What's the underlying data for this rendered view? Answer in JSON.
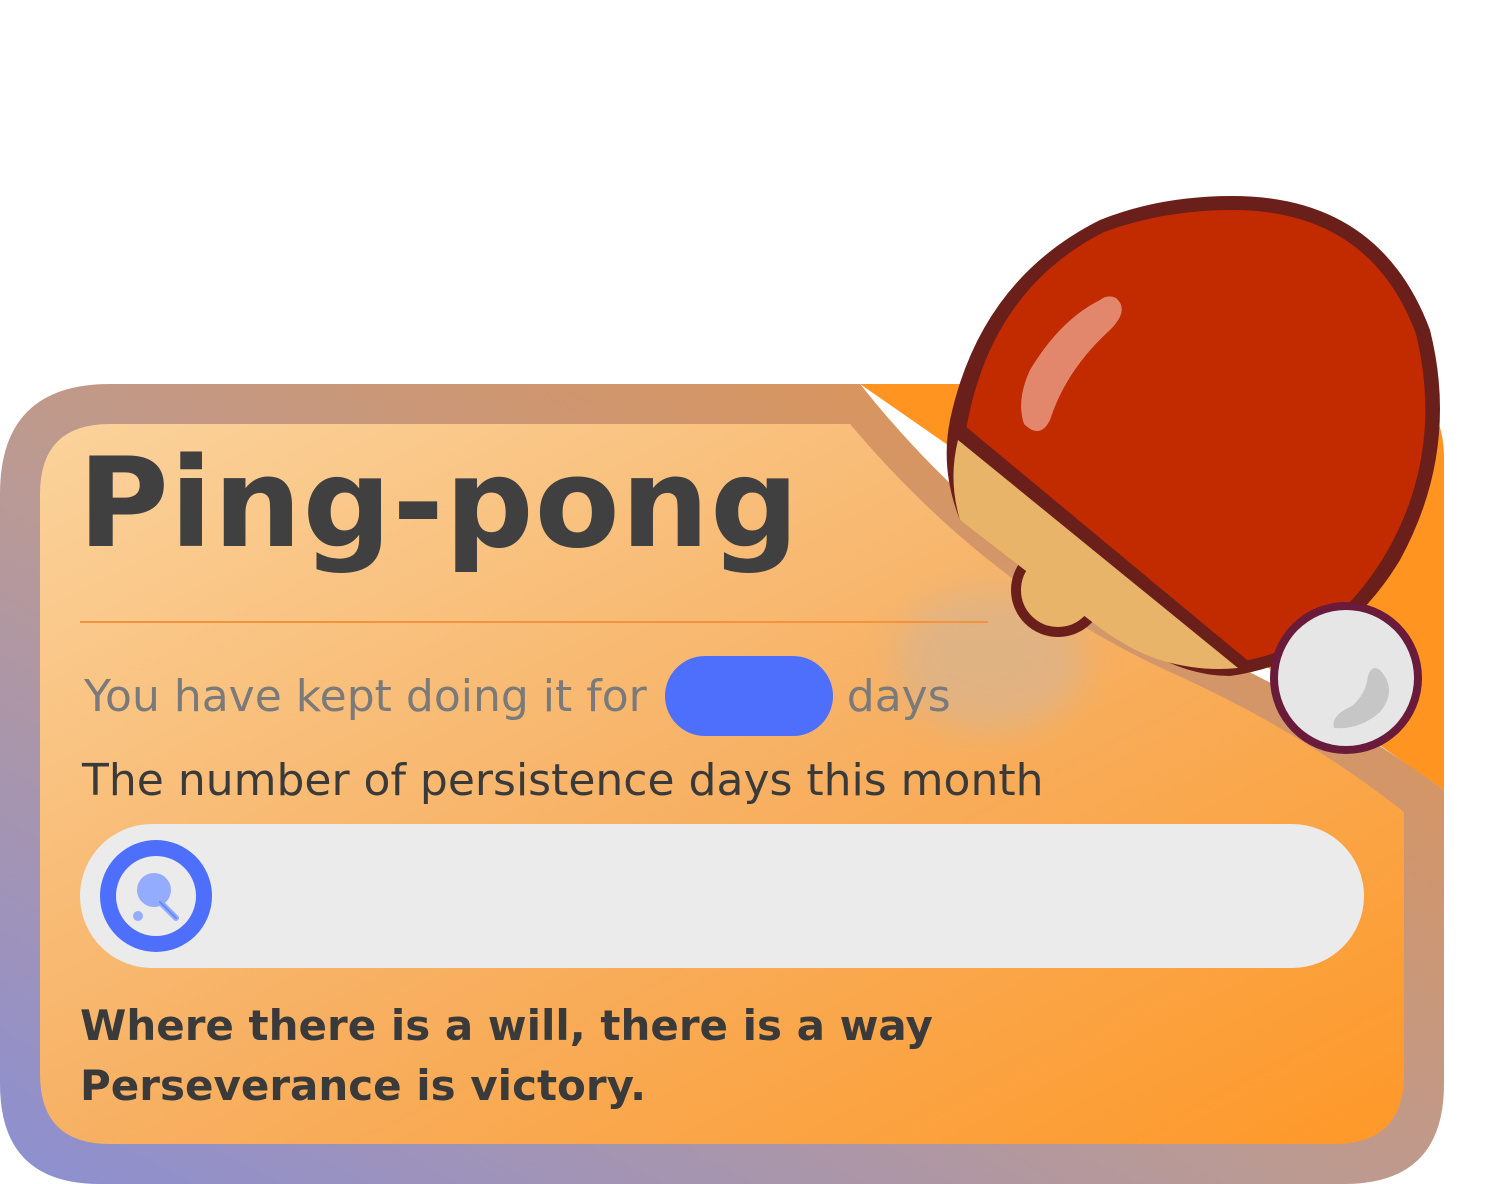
{
  "card": {
    "title": "Ping-pong",
    "kept_prefix": "You have kept doing it for",
    "kept_days_value": "",
    "kept_suffix": "days",
    "month_label": "The number of persistence days this month",
    "month_progress_fraction": 0,
    "quote_line_1": "Where there is a will, there is a way",
    "quote_line_2": "Perseverance is victory."
  },
  "icons": {
    "paddle": "ping-pong-paddle-icon",
    "ball": "ping-pong-ball-icon",
    "marker": "ping-pong-marker-icon"
  },
  "colors": {
    "accent_blue": "#4e6ffb",
    "orange": "#ff9a2a",
    "paddle_red": "#c02a00",
    "title_text": "#404040"
  }
}
